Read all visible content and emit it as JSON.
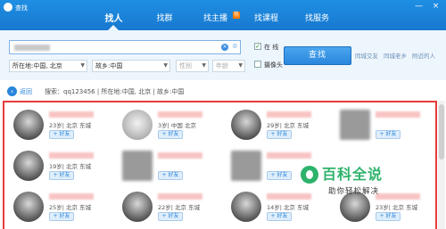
{
  "window": {
    "title": "查找",
    "controls": [
      "—",
      "×"
    ]
  },
  "tabs": [
    {
      "label": "找人",
      "active": true
    },
    {
      "label": "找群",
      "active": false
    },
    {
      "label": "找主播",
      "active": false,
      "badge": "热"
    },
    {
      "label": "找课程",
      "active": false
    },
    {
      "label": "找服务",
      "active": false
    }
  ],
  "search": {
    "online_label": "在 线",
    "online_checked": true,
    "camera_label": "摄像头",
    "camera_checked": false,
    "button_label": "查找",
    "links": [
      "同城交友",
      "同城老乡",
      "附近的人"
    ],
    "filters": {
      "location": "所在地:中国, 北京",
      "hometown": "故乡:中国",
      "gender": "性别",
      "age": "年龄"
    }
  },
  "breadcrumb": {
    "back_label": "返回",
    "prefix": "搜索：",
    "query": "qq123456",
    "location": "所在地:中国, 北京",
    "hometown": "故乡:中国"
  },
  "results": {
    "add_label": "+ 好友",
    "cards": [
      {
        "info": "23岁| 北京 东城"
      },
      {
        "info": "3岁| 中国 北京"
      },
      {
        "info": "29岁| 北京 东城"
      },
      {
        "info": ""
      },
      {
        "info": "19岁| 北京 东城"
      },
      {
        "info": ""
      },
      {
        "info": ""
      },
      {
        "info": ""
      },
      {
        "info": "25岁| 北京 东城"
      },
      {
        "info": "22岁| 北京 东城"
      },
      {
        "info": "14岁| 北京 东城"
      },
      {
        "info": "23岁| 北京 东城"
      }
    ]
  },
  "watermark": {
    "title": "百科全说",
    "subtitle": "助你轻松解决"
  }
}
